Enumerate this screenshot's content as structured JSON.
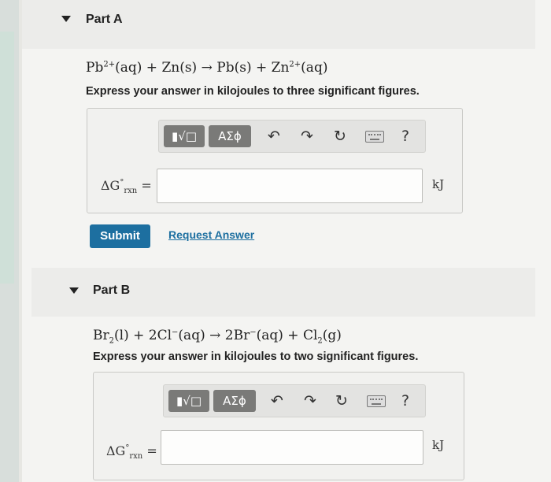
{
  "part_a": {
    "title": "Part A",
    "equation": {
      "r1": "Pb",
      "r1_charge": "2+",
      "r1_state": "(aq)",
      "plus1": " + ",
      "r2": "Zn",
      "r2_state": "(s)",
      "arrow": " → ",
      "p1": "Pb",
      "p1_state": "(s)",
      "plus2": " + ",
      "p2": "Zn",
      "p2_charge": "2+",
      "p2_state": "(aq)"
    },
    "instruction": "Express your answer in kilojoules to three significant figures.",
    "toolbar": {
      "templates_label": "▮√□",
      "symbols_label": "ΑΣϕ",
      "help_label": "?"
    },
    "label": {
      "delta_g": "ΔG",
      "sup": "°",
      "sub": "rxn",
      "equals": "="
    },
    "input_value": "",
    "unit": "kJ",
    "submit_label": "Submit",
    "request_answer_label": "Request Answer"
  },
  "part_b": {
    "title": "Part B",
    "equation": {
      "r1": "Br",
      "r1_sub": "2",
      "r1_state": "(l)",
      "plus1": " + ",
      "r2": "2Cl",
      "r2_charge": "−",
      "r2_state": "(aq)",
      "arrow": " → ",
      "p1": "2Br",
      "p1_charge": "−",
      "p1_state": "(aq)",
      "plus2": " + ",
      "p2": "Cl",
      "p2_sub": "2",
      "p2_state": "(g)"
    },
    "instruction": "Express your answer in kilojoules to two significant figures.",
    "toolbar": {
      "templates_label": "▮√□",
      "symbols_label": "ΑΣϕ",
      "help_label": "?"
    },
    "label": {
      "delta_g": "ΔG",
      "sup": "°",
      "sub": "rxn",
      "equals": "="
    },
    "input_value": "",
    "unit": "kJ"
  },
  "icons": {
    "undo": "undo-icon",
    "redo": "redo-icon",
    "reset": "reset-icon",
    "keyboard": "keyboard-icon",
    "help": "help-icon",
    "expand": "triangle-down-icon"
  },
  "colors": {
    "primary": "#1d6fa0",
    "toolbar_button": "#7a7a78"
  }
}
